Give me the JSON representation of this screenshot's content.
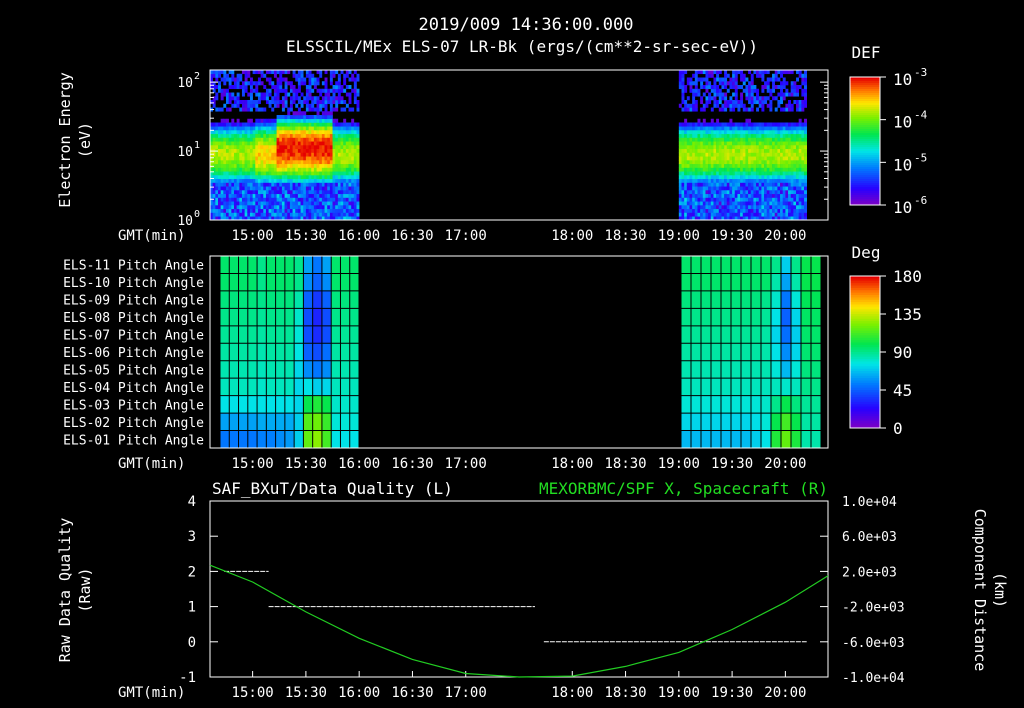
{
  "header": {
    "title": "2019/009 14:36:00.000",
    "subtitle": "ELSSCIL/MEx ELS-07 LR-Bk  (ergs/(cm**2-sr-sec-eV))"
  },
  "colors": {
    "background": "#000000",
    "foreground": "#ffffff",
    "spacecraft_line": "#22cc22",
    "right_title_color": "#22dd22"
  },
  "time_axis": {
    "label": "GMT(min)",
    "tick_labels": [
      "15:00",
      "15:30",
      "16:00",
      "16:30",
      "17:00",
      "18:00",
      "18:30",
      "19:00",
      "19:30",
      "20:00"
    ],
    "tick_minutes": [
      900,
      930,
      960,
      990,
      1020,
      1080,
      1110,
      1140,
      1170,
      1200
    ],
    "range_minutes": [
      876,
      1224
    ]
  },
  "chart_data": [
    {
      "type": "heatmap",
      "name": "energy_spectrogram",
      "ylabel": "Electron Energy\n(eV)",
      "ylabel_lines": [
        "Electron Energy",
        "(eV)"
      ],
      "yscale": "log",
      "ylim": [
        1,
        150
      ],
      "ytick_labels": [
        {
          "base": "10",
          "exp": "0",
          "value": 1
        },
        {
          "base": "10",
          "exp": "1",
          "value": 10
        },
        {
          "base": "10",
          "exp": "2",
          "value": 100
        }
      ],
      "data_gaps_minutes": [
        [
          959,
          1140
        ]
      ],
      "data_intervals_minutes": [
        [
          876,
          959
        ],
        [
          1140,
          1212
        ]
      ],
      "colorbar": {
        "title": "DEF",
        "scale": "log",
        "range": [
          1e-06,
          0.001
        ],
        "tick_labels": [
          {
            "base": "10",
            "exp": "-3"
          },
          {
            "base": "10",
            "exp": "-4"
          },
          {
            "base": "10",
            "exp": "-5"
          },
          {
            "base": "10",
            "exp": "-6"
          }
        ]
      }
    },
    {
      "type": "heatmap",
      "name": "pitch_angle",
      "rows": [
        "ELS-11 Pitch Angle",
        "ELS-10 Pitch Angle",
        "ELS-09 Pitch Angle",
        "ELS-08 Pitch Angle",
        "ELS-07 Pitch Angle",
        "ELS-06 Pitch Angle",
        "ELS-05 Pitch Angle",
        "ELS-04 Pitch Angle",
        "ELS-03 Pitch Angle",
        "ELS-02 Pitch Angle",
        "ELS-01 Pitch Angle"
      ],
      "data_gaps_minutes": [
        [
          960,
          1140
        ]
      ],
      "values_deg_left_interval": [
        [
          95,
          95,
          95,
          95,
          90,
          95,
          95,
          95,
          90,
          60,
          50,
          60,
          95,
          95,
          95
        ],
        [
          95,
          95,
          95,
          95,
          90,
          95,
          95,
          95,
          90,
          55,
          45,
          55,
          95,
          95,
          95
        ],
        [
          92,
          92,
          92,
          92,
          90,
          92,
          92,
          92,
          85,
          45,
          35,
          45,
          92,
          92,
          92
        ],
        [
          90,
          90,
          90,
          90,
          88,
          90,
          90,
          90,
          80,
          40,
          30,
          40,
          90,
          90,
          90
        ],
        [
          88,
          88,
          88,
          88,
          86,
          88,
          88,
          88,
          78,
          40,
          32,
          40,
          88,
          88,
          88
        ],
        [
          86,
          86,
          86,
          86,
          84,
          86,
          86,
          86,
          76,
          45,
          40,
          48,
          86,
          86,
          86
        ],
        [
          84,
          84,
          84,
          84,
          82,
          84,
          84,
          84,
          72,
          55,
          50,
          55,
          84,
          84,
          84
        ],
        [
          82,
          82,
          82,
          82,
          80,
          82,
          82,
          82,
          72,
          75,
          70,
          72,
          82,
          82,
          82
        ],
        [
          75,
          75,
          75,
          75,
          75,
          75,
          75,
          75,
          72,
          100,
          105,
          100,
          80,
          80,
          80
        ],
        [
          60,
          60,
          60,
          60,
          62,
          62,
          62,
          62,
          70,
          115,
          120,
          110,
          78,
          78,
          78
        ],
        [
          50,
          50,
          50,
          50,
          52,
          52,
          55,
          58,
          70,
          118,
          125,
          112,
          75,
          75,
          75
        ]
      ],
      "values_deg_right_interval": [
        [
          95,
          95,
          95,
          95,
          95,
          95,
          95,
          95,
          95,
          90,
          70,
          90,
          100,
          100
        ],
        [
          95,
          95,
          95,
          95,
          95,
          95,
          95,
          95,
          95,
          85,
          60,
          85,
          100,
          100
        ],
        [
          92,
          92,
          92,
          92,
          92,
          92,
          92,
          92,
          90,
          80,
          50,
          78,
          98,
          98
        ],
        [
          90,
          90,
          90,
          90,
          90,
          90,
          90,
          90,
          88,
          75,
          45,
          72,
          96,
          96
        ],
        [
          88,
          88,
          88,
          88,
          88,
          88,
          88,
          88,
          86,
          72,
          48,
          70,
          95,
          95
        ],
        [
          86,
          86,
          86,
          86,
          86,
          86,
          86,
          86,
          85,
          75,
          55,
          72,
          94,
          94
        ],
        [
          84,
          84,
          84,
          84,
          84,
          84,
          84,
          84,
          84,
          78,
          65,
          78,
          92,
          92
        ],
        [
          82,
          82,
          82,
          82,
          82,
          82,
          82,
          82,
          82,
          82,
          80,
          82,
          90,
          90
        ],
        [
          78,
          78,
          78,
          78,
          78,
          78,
          78,
          78,
          80,
          90,
          100,
          92,
          88,
          88
        ],
        [
          72,
          72,
          72,
          72,
          72,
          72,
          72,
          74,
          78,
          100,
          112,
          100,
          86,
          86
        ],
        [
          65,
          65,
          65,
          65,
          65,
          65,
          66,
          70,
          75,
          105,
          118,
          104,
          85,
          85
        ]
      ],
      "colorbar": {
        "title": "Deg",
        "range": [
          0,
          180
        ],
        "tick_labels": [
          "180",
          "135",
          "90",
          "45",
          "0"
        ],
        "tick_values": [
          180,
          135,
          90,
          45,
          0
        ]
      }
    },
    {
      "type": "line",
      "name": "data_quality_and_position",
      "left_title": "SAF_BXuT/Data Quality (L)",
      "right_title": "MEXORBMC/SPF X, Spacecraft (R)",
      "ylabel_left_lines": [
        "Raw Data Quality",
        "(Raw)"
      ],
      "ylabel_right_lines": [
        "Component Distance",
        "(km)"
      ],
      "ylim_left": [
        -1,
        4
      ],
      "ytick_left_labels": [
        "4",
        "3",
        "2",
        "1",
        "0",
        "-1"
      ],
      "ytick_left_values": [
        4,
        3,
        2,
        1,
        0,
        -1
      ],
      "ylim_right": [
        -10000,
        10000
      ],
      "ytick_right_labels": [
        "1.0e+04",
        "6.0e+03",
        "2.0e+03",
        "-2.0e+03",
        "-6.0e+03",
        "-1.0e+04"
      ],
      "ytick_right_values": [
        10000,
        6000,
        2000,
        -2000,
        -6000,
        -10000
      ],
      "series": [
        {
          "axis": "left",
          "style": "dashed-white",
          "segments": [
            {
              "x": [
                884,
                909
              ],
              "y": 2
            },
            {
              "x": [
                909,
                1059
              ],
              "y": 1
            },
            {
              "x": [
                1064,
                1212
              ],
              "y": 0
            }
          ],
          "x": [
            884,
            909,
            909,
            1059,
            1064,
            1212
          ],
          "y": [
            2,
            2,
            1,
            1,
            0,
            0
          ]
        },
        {
          "axis": "right",
          "style": "solid-green",
          "x": [
            876,
            900,
            930,
            960,
            990,
            1020,
            1050,
            1080,
            1110,
            1140,
            1170,
            1200,
            1224
          ],
          "y": [
            2700,
            800,
            -2600,
            -5600,
            -8000,
            -9600,
            -10200,
            -9900,
            -8800,
            -7200,
            -4600,
            -1500,
            1500
          ]
        }
      ]
    }
  ]
}
